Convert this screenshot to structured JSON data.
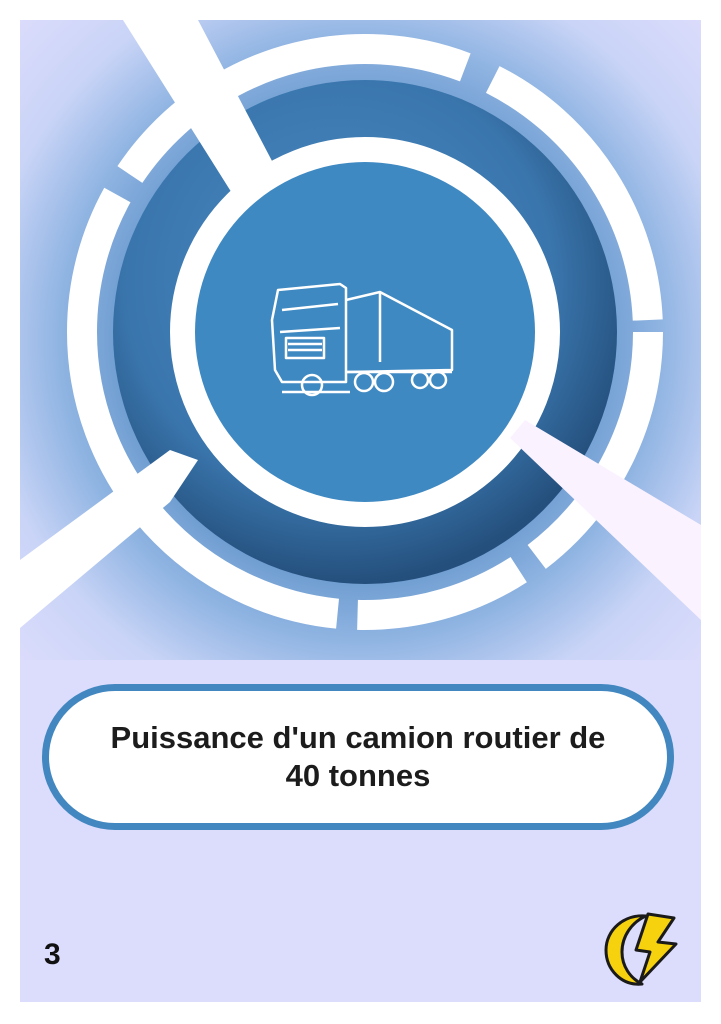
{
  "card": {
    "title": "Puissance d'un camion routier de 40 tonnes",
    "number": "3"
  },
  "illustration": {
    "icon": "truck-icon",
    "ring_colors": [
      "#3e7db5",
      "#2a5a8a"
    ],
    "center_color": "#3f89c2"
  },
  "corner_icon": "energy-moon-bolt-icon",
  "colors": {
    "background": "#dcdcfc",
    "accent": "#4287c0",
    "bolt": "#f5d10e"
  }
}
